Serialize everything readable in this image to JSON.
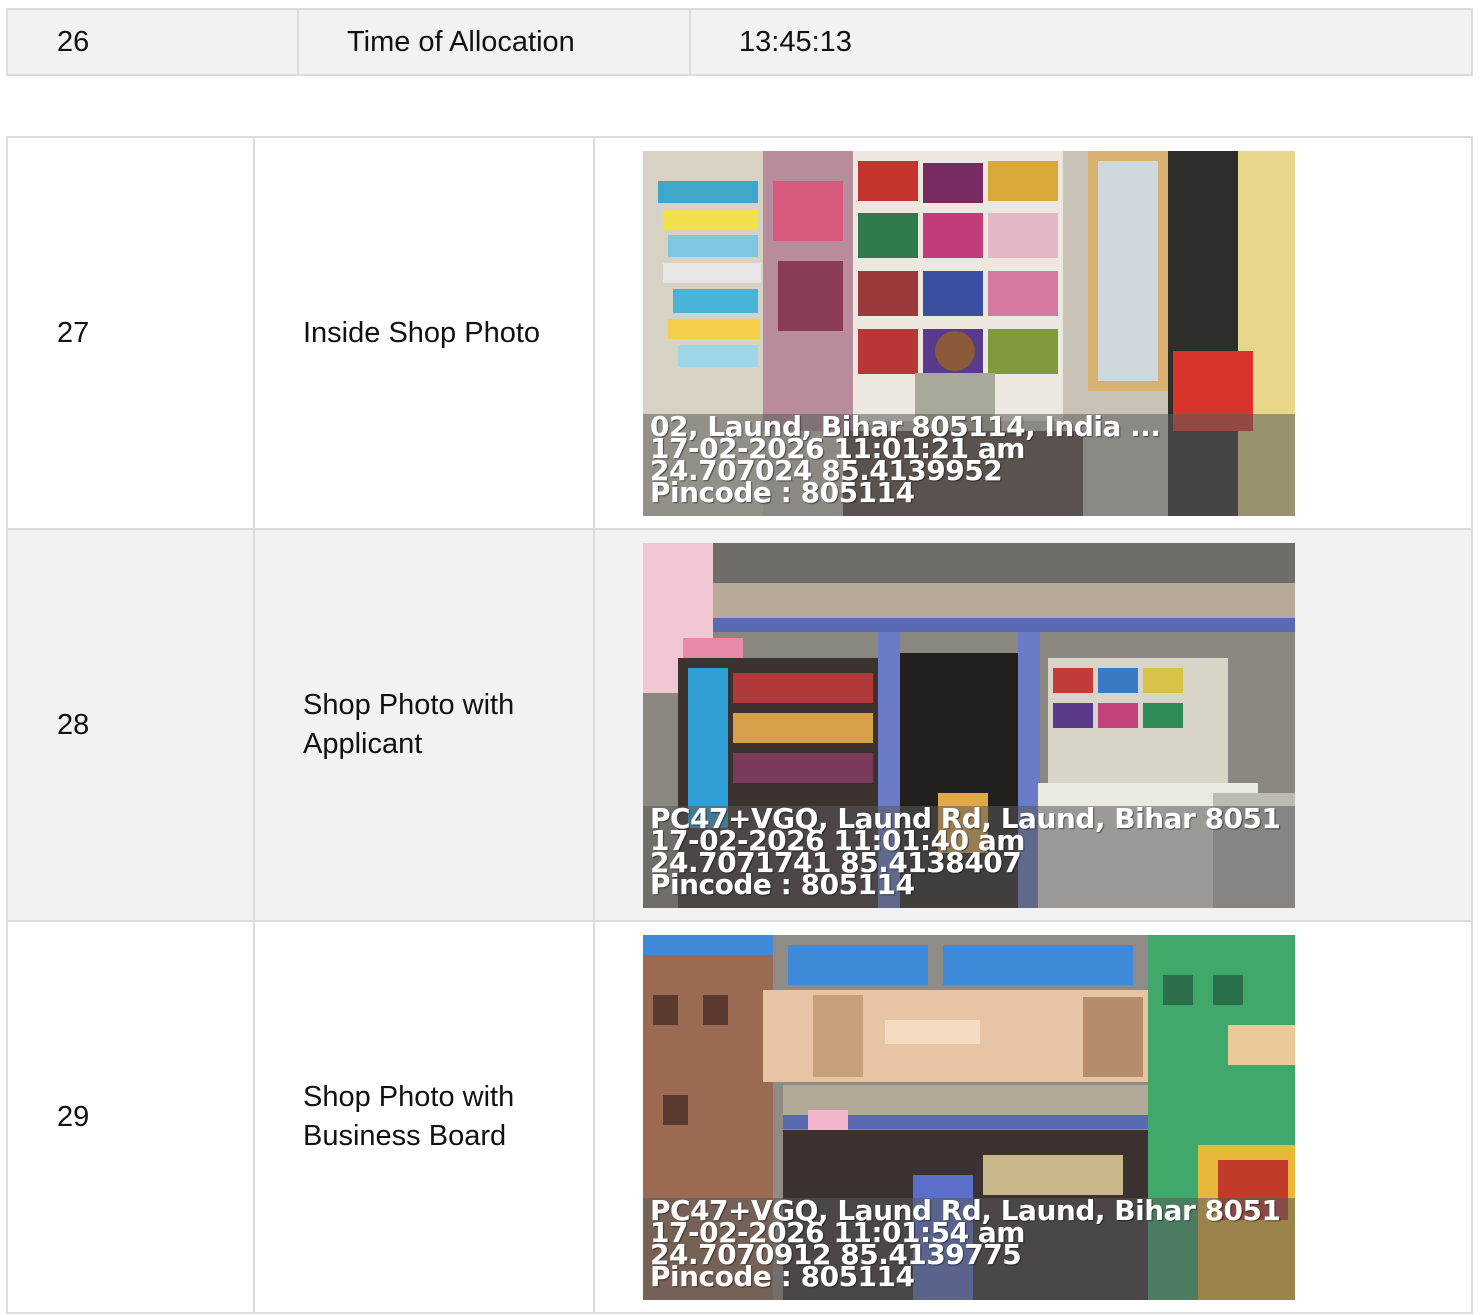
{
  "allocation_row": {
    "number": "26",
    "label": "Time of Allocation",
    "value": "13:45:13"
  },
  "photo_rows": [
    {
      "number": "27",
      "label": "Inside Shop Photo",
      "photo_icon": "shop-interior-photo",
      "overlay": {
        "address": "02, Laund, Bihar 805114, India ...",
        "datetime": "17-02-2026 11:01:21 am",
        "coordinates": "24.707024 85.4139952",
        "pincode": "Pincode : 805114"
      }
    },
    {
      "number": "28",
      "label": "Shop Photo with Applicant",
      "photo_icon": "shop-front-photo",
      "overlay": {
        "address": "PC47+VGQ, Laund Rd, Laund, Bihar 8051",
        "datetime": "17-02-2026 11:01:40 am",
        "coordinates": "24.7071741 85.4138407",
        "pincode": "Pincode : 805114"
      }
    },
    {
      "number": "29",
      "label": "Shop Photo with Business Board",
      "photo_icon": "shop-board-photo",
      "overlay": {
        "address": "PC47+VGQ, Laund Rd, Laund, Bihar 8051",
        "datetime": "17-02-2026 11:01:54 am",
        "coordinates": "24.7070912 85.4139775",
        "pincode": "Pincode : 805114"
      }
    }
  ]
}
